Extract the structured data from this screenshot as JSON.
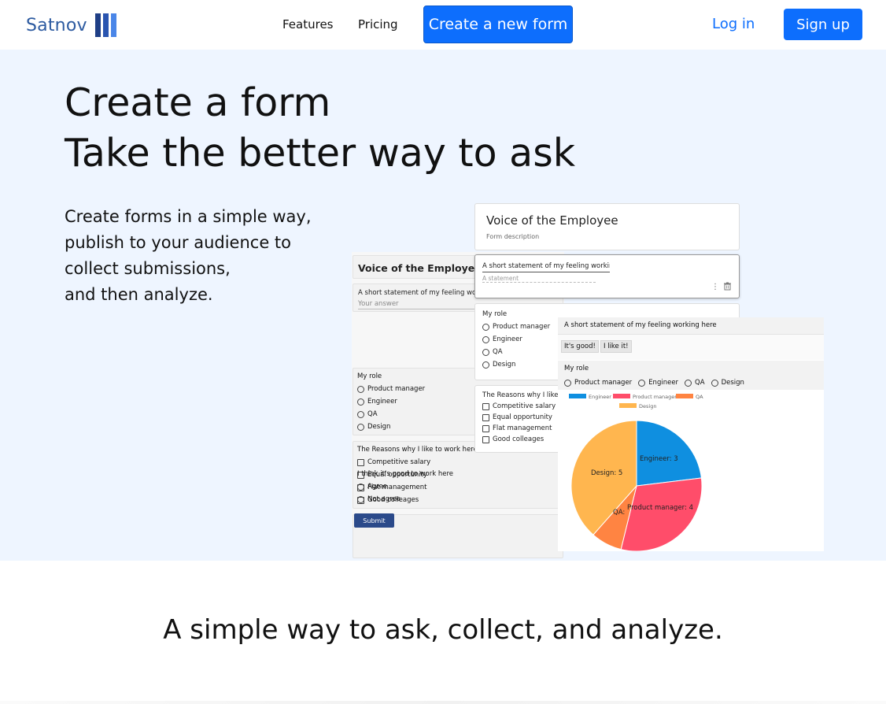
{
  "nav": {
    "brand": "Satnov",
    "features": "Features",
    "pricing": "Pricing",
    "create_form": "Create a new form",
    "login": "Log in",
    "signup": "Sign up"
  },
  "hero": {
    "title_line1": "Create a form",
    "title_line2": "Take the better way to ask",
    "desc_line1": "Create forms in a simple way,",
    "desc_line2": "publish to your audience to",
    "desc_line3": "collect submissions,",
    "desc_line4": "and then analyze."
  },
  "preview_form": {
    "title": "Voice of the Employee",
    "q1": "A short statement of my feeling working here",
    "q1_placeholder": "Your answer",
    "q2": "My role",
    "q2_options": [
      "Product manager",
      "Engineer",
      "QA",
      "Design"
    ],
    "q3": "The Reasons why I like to work here",
    "q3_options": [
      "Competitive salary",
      "Equal opportunity",
      "Flat management",
      "Good colleages"
    ],
    "q4": "I think it's good to work here",
    "q4_options": [
      "Agree",
      "Not agree"
    ],
    "submit": "Submit"
  },
  "editor_form": {
    "title": "Voice of the Employee",
    "description": "Form description",
    "q1": "A short statement of my feeling working here",
    "q1_placeholder": "A statement",
    "q2": "My role",
    "q2_options": [
      "Product manager",
      "Engineer",
      "QA",
      "Design"
    ],
    "q3": "The Reasons why I like to w",
    "q3_options": [
      "Competitive salary",
      "Equal opportunity",
      "Flat management",
      "Good colleages"
    ]
  },
  "results": {
    "q1": "A short statement of my feeling working here",
    "answers": [
      "It's good!",
      "I like it!"
    ],
    "q2": "My role",
    "q2_options": [
      "Product manager",
      "Engineer",
      "QA",
      "Design"
    ]
  },
  "chart_data": {
    "type": "pie",
    "categories": [
      "Engineer",
      "Product manager",
      "QA",
      "Design"
    ],
    "values": [
      3,
      4,
      1,
      5
    ],
    "labels": [
      "Engineer: 3",
      "Product manager: 4",
      "QA:",
      "Design: 5"
    ],
    "colors": [
      "#0f8fe0",
      "#ff4d6a",
      "#ff8442",
      "#ffb64f"
    ],
    "legend": "top"
  },
  "tagline": "A simple way to ask, collect, and analyze."
}
